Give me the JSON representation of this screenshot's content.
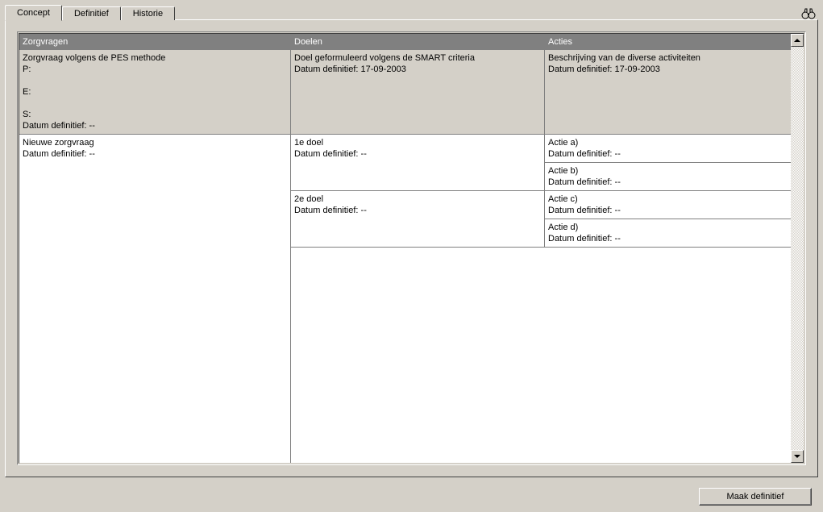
{
  "tabs": {
    "concept": "Concept",
    "definitief": "Definitief",
    "historie": "Historie"
  },
  "headers": {
    "zorgvragen": "Zorgvragen",
    "doelen": "Doelen",
    "acties": "Acties"
  },
  "section_row": {
    "zorg_line1": "Zorgvraag volgens de PES methode",
    "zorg_line2": "P:",
    "zorg_line3": "E:",
    "zorg_line4": "S:",
    "zorg_line5": "Datum definitief: --",
    "doel_line1": "Doel geformuleerd volgens de SMART criteria",
    "doel_line2": "Datum definitief: 17-09-2003",
    "actie_line1": "Beschrijving van de diverse activiteiten",
    "actie_line2": "Datum definitief: 17-09-2003"
  },
  "data": {
    "zorg_line1": "Nieuwe zorgvraag",
    "zorg_line2": "Datum definitief: --",
    "doel1_line1": "1e doel",
    "doel1_line2": "Datum definitief: --",
    "doel2_line1": "2e doel",
    "doel2_line2": "Datum definitief: --",
    "actie_a_line1": "Actie a)",
    "actie_a_line2": "Datum definitief: --",
    "actie_b_line1": "Actie b)",
    "actie_b_line2": "Datum definitief: --",
    "actie_c_line1": "Actie c)",
    "actie_c_line2": "Datum definitief: --",
    "actie_d_line1": "Actie d)",
    "actie_d_line2": "Datum definitief: --"
  },
  "buttons": {
    "maak_definitief": "Maak definitief"
  }
}
